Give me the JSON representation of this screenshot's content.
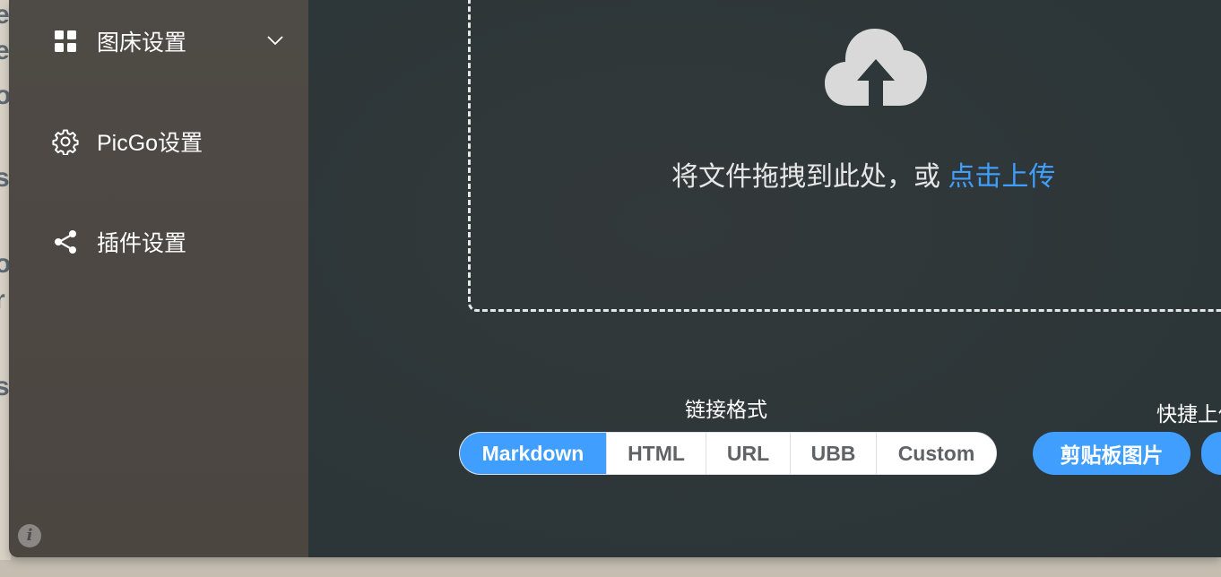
{
  "background_window": {
    "edge_letters": [
      "e",
      "e",
      "o",
      "s",
      "o",
      "r",
      "s"
    ]
  },
  "sidebar": {
    "items": [
      {
        "label": "图床设置",
        "icon": "grid-icon",
        "has_chevron": true
      },
      {
        "label": "PicGo设置",
        "icon": "gear-icon"
      },
      {
        "label": "插件设置",
        "icon": "share-icon"
      }
    ],
    "info_icon_glyph": "i"
  },
  "upload": {
    "drop_text": "将文件拖拽到此处，或 ",
    "click_upload": "点击上传"
  },
  "link_format": {
    "label": "链接格式",
    "options": [
      "Markdown",
      "HTML",
      "URL",
      "UBB",
      "Custom"
    ],
    "selected": "Markdown"
  },
  "quick_upload": {
    "label": "快捷上传",
    "clipboard_button": "剪贴板图片"
  },
  "colors": {
    "accent": "#409eff",
    "sidebar_bg": "#4e4a45",
    "main_bg": "#2d3638"
  }
}
